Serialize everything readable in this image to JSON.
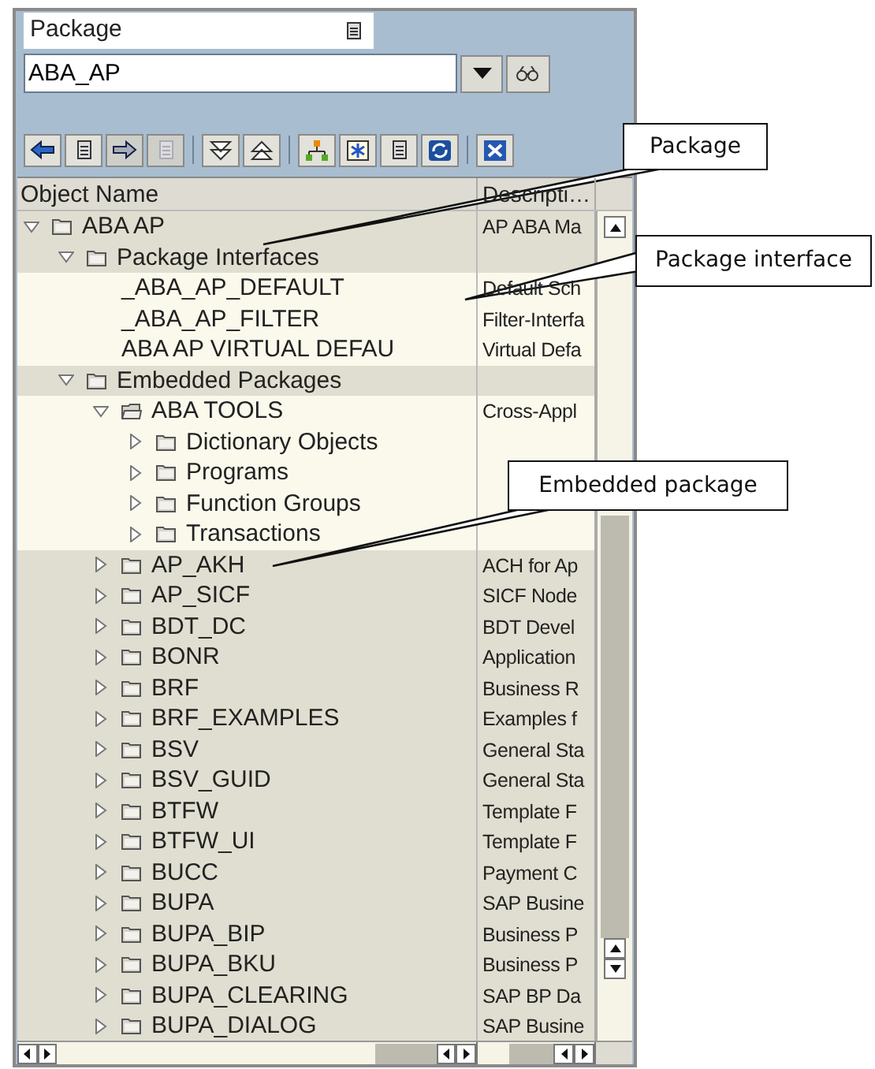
{
  "package_field": {
    "label": "Package",
    "value": "ABA_AP"
  },
  "toolbar": [
    {
      "kind": "back",
      "disabled": false
    },
    {
      "kind": "doc",
      "disabled": false
    },
    {
      "kind": "forward",
      "disabled": true
    },
    {
      "kind": "doc",
      "disabled": true
    },
    {
      "kind": "sep"
    },
    {
      "kind": "expand",
      "disabled": false
    },
    {
      "kind": "collapse",
      "disabled": false
    },
    {
      "kind": "sep"
    },
    {
      "kind": "hierarchy",
      "disabled": false
    },
    {
      "kind": "star",
      "disabled": false
    },
    {
      "kind": "doc",
      "disabled": false
    },
    {
      "kind": "refresh",
      "disabled": false
    },
    {
      "kind": "sep"
    },
    {
      "kind": "close",
      "disabled": false
    }
  ],
  "columns": [
    "Object Name",
    "Descripti…"
  ],
  "tree": [
    {
      "name": "ABA AP",
      "description": "AP ABA Ma",
      "kind": "folder",
      "expanded": true,
      "shaded": true,
      "children": [
        {
          "name": "Package Interfaces",
          "kind": "folder",
          "expanded": true,
          "shaded": true,
          "children": [
            {
              "name": "_ABA_AP_DEFAULT",
              "description": "Default Sch",
              "kind": "item",
              "shaded": false
            },
            {
              "name": "_ABA_AP_FILTER",
              "description": "Filter-Interfa",
              "kind": "item",
              "shaded": false
            },
            {
              "name": "ABA AP VIRTUAL DEFAU",
              "description": "Virtual Defa",
              "kind": "item",
              "shaded": false
            }
          ]
        },
        {
          "name": "Embedded Packages",
          "kind": "folder",
          "expanded": true,
          "shaded": true,
          "children": [
            {
              "name": "ABA TOOLS",
              "description": "Cross-Appl",
              "kind": "open_folder",
              "expanded": true,
              "shaded": false,
              "children": [
                {
                  "name": "Dictionary Objects",
                  "kind": "folder",
                  "expanded": false,
                  "shaded": false
                },
                {
                  "name": "Programs",
                  "kind": "folder",
                  "expanded": false,
                  "shaded": false
                },
                {
                  "name": "Function Groups",
                  "kind": "folder",
                  "expanded": false,
                  "shaded": false
                },
                {
                  "name": "Transactions",
                  "kind": "folder",
                  "expanded": false,
                  "shaded": false
                }
              ]
            },
            {
              "name": "AP_AKH",
              "description": "ACH for Ap",
              "kind": "folder",
              "expanded": false,
              "shaded": true
            },
            {
              "name": "AP_SICF",
              "description": "SICF Node",
              "kind": "folder",
              "expanded": false,
              "shaded": true
            },
            {
              "name": "BDT_DC",
              "description": "BDT Devel",
              "kind": "folder",
              "expanded": false,
              "shaded": true
            },
            {
              "name": "BONR",
              "description": "Application",
              "kind": "folder",
              "expanded": false,
              "shaded": true
            },
            {
              "name": "BRF",
              "description": "Business R",
              "kind": "folder",
              "expanded": false,
              "shaded": true
            },
            {
              "name": "BRF_EXAMPLES",
              "description": "Examples f",
              "kind": "folder",
              "expanded": false,
              "shaded": true
            },
            {
              "name": "BSV",
              "description": "General Sta",
              "kind": "folder",
              "expanded": false,
              "shaded": true
            },
            {
              "name": "BSV_GUID",
              "description": "General Sta",
              "kind": "folder",
              "expanded": false,
              "shaded": true
            },
            {
              "name": "BTFW",
              "description": "Template F",
              "kind": "folder",
              "expanded": false,
              "shaded": true
            },
            {
              "name": "BTFW_UI",
              "description": "Template F",
              "kind": "folder",
              "expanded": false,
              "shaded": true
            },
            {
              "name": "BUCC",
              "description": "Payment C",
              "kind": "folder",
              "expanded": false,
              "shaded": true
            },
            {
              "name": "BUPA",
              "description": "SAP Busine",
              "kind": "folder",
              "expanded": false,
              "shaded": true
            },
            {
              "name": "BUPA_BIP",
              "description": "Business P",
              "kind": "folder",
              "expanded": false,
              "shaded": true
            },
            {
              "name": "BUPA_BKU",
              "description": "Business P",
              "kind": "folder",
              "expanded": false,
              "shaded": true
            },
            {
              "name": "BUPA_CLEARING",
              "description": "SAP BP Da",
              "kind": "folder",
              "expanded": false,
              "shaded": true
            },
            {
              "name": "BUPA_DIALOG",
              "description": "SAP Busine",
              "kind": "folder",
              "expanded": false,
              "shaded": true
            }
          ]
        }
      ]
    }
  ],
  "callouts": [
    {
      "text": "Package"
    },
    {
      "text": "Package interface"
    },
    {
      "text": "Embedded package"
    }
  ]
}
